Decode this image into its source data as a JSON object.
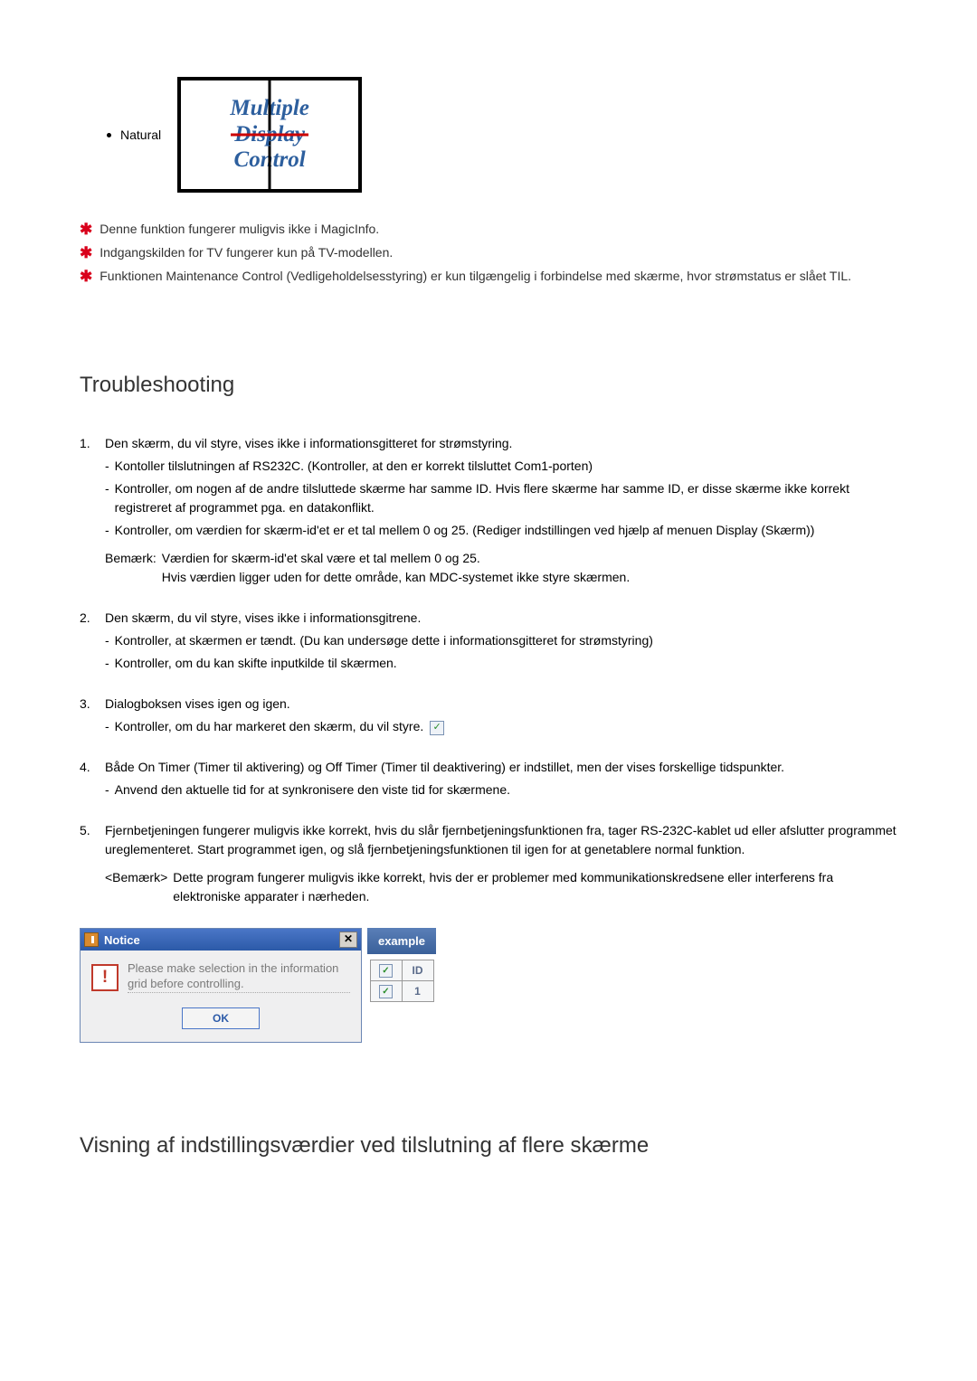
{
  "top": {
    "natural_label": "Natural",
    "mdc_line1": "Multiple",
    "mdc_line2": "Display",
    "mdc_line3": "Control"
  },
  "star_notes": [
    "Denne funktion fungerer muligvis ikke i MagicInfo.",
    "Indgangskilden for TV fungerer kun på TV-modellen.",
    "Funktionen Maintenance Control (Vedligeholdelsesstyring) er kun tilgængelig i forbindelse med skærme, hvor strømstatus er slået TIL."
  ],
  "sections": {
    "troubleshooting_heading": "Troubleshooting",
    "multi_heading": "Visning af indstillingsværdier ved tilslutning af flere skærme"
  },
  "ts": [
    {
      "num": "1.",
      "title": "Den skærm, du vil styre, vises ikke i informationsgitteret for strømstyring.",
      "subs": [
        "Kontoller tilslutningen af RS232C. (Kontroller, at den er korrekt tilsluttet Com1-porten)",
        "Kontroller, om nogen af de andre tilsluttede skærme har samme ID. Hvis flere skærme har samme ID, er disse skærme ikke korrekt registreret af programmet pga. en datakonflikt.",
        "Kontroller, om værdien for skærm-id'et er et tal mellem 0 og 25. (Rediger indstillingen ved hjælp af menuen Display (Skærm))"
      ],
      "note_label": "Bemærk:",
      "note_text_1": "Værdien for skærm-id'et skal være et tal mellem 0 og 25.",
      "note_text_2": "Hvis værdien ligger uden for dette område, kan MDC-systemet ikke styre skærmen."
    },
    {
      "num": "2.",
      "title": "Den skærm, du vil styre, vises ikke i informationsgitrene.",
      "subs": [
        "Kontroller, at skærmen er tændt. (Du kan undersøge dette i informationsgitteret for strømstyring)",
        "Kontroller, om du kan skifte inputkilde til skærmen."
      ]
    },
    {
      "num": "3.",
      "title": "Dialogboksen vises igen og igen.",
      "subs": [
        "Kontroller, om du har markeret den skærm, du vil styre."
      ],
      "has_check_icon": true
    },
    {
      "num": "4.",
      "title": "Både On Timer (Timer til aktivering) og Off Timer (Timer til deaktivering) er indstillet, men der vises forskellige tidspunkter.",
      "subs": [
        "Anvend den aktuelle tid for at synkronisere den viste tid for skærmene."
      ]
    },
    {
      "num": "5.",
      "title": "Fjernbetjeningen fungerer muligvis ikke korrekt, hvis du slår fjernbetjeningsfunktionen fra, tager RS-232C-kablet ud eller afslutter programmet ureglementeret. Start programmet igen, og slå fjernbetjeningsfunktionen til igen for at genetablere normal funktion.",
      "subs": [],
      "note2_label": "<Bemærk>",
      "note2_text": "Dette program fungerer muligvis ikke korrekt, hvis der er problemer med kommunikationskredsene eller interferens fra elektroniske apparater i nærheden."
    }
  ],
  "dialog": {
    "title": "Notice",
    "message": "Please make selection in the information grid before controlling.",
    "ok_label": "OK",
    "close_glyph": "✕",
    "alert_glyph": "!"
  },
  "example": {
    "label": "example",
    "header_col2": "ID",
    "row1_col2": "1"
  }
}
